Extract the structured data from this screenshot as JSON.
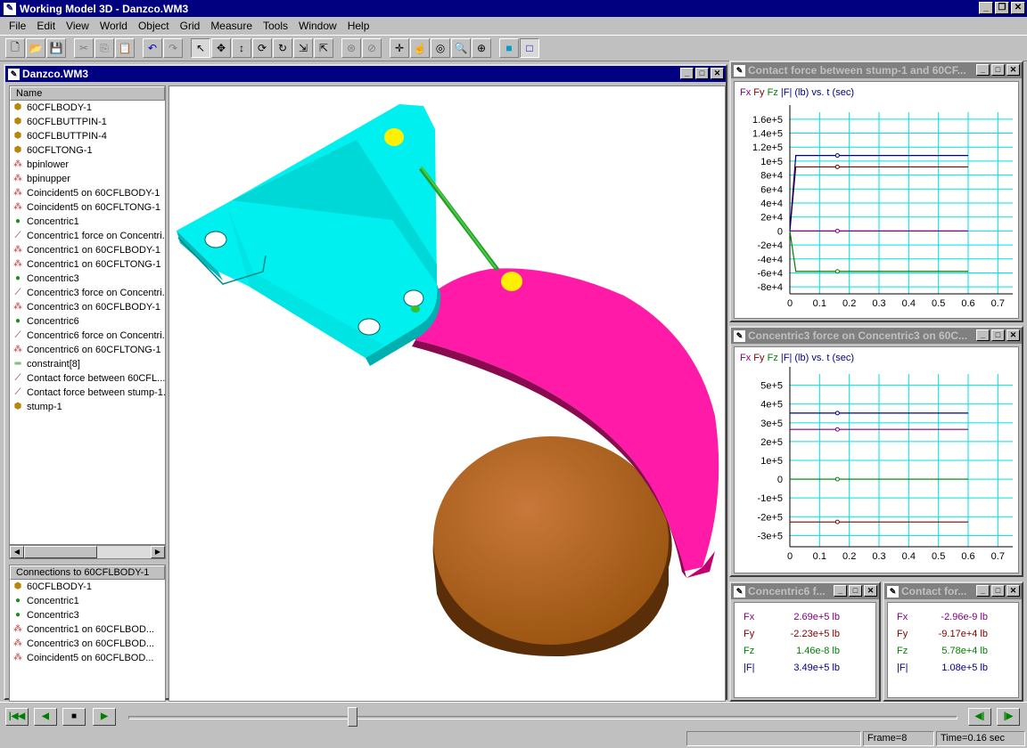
{
  "app": {
    "title": "Working Model 3D - Danzco.WM3"
  },
  "menu": [
    "File",
    "Edit",
    "View",
    "World",
    "Object",
    "Grid",
    "Measure",
    "Tools",
    "Window",
    "Help"
  ],
  "toolbar_icons": [
    "new",
    "open",
    "save",
    "cut",
    "copy",
    "paste",
    "undo",
    "redo",
    "pointer",
    "move",
    "rotate",
    "orbit",
    "spin",
    "join",
    "split",
    "anchor",
    "unanchor",
    "pan",
    "rotate-view",
    "zoom-window",
    "zoom-fit",
    "shaded-view",
    "wireframe-view"
  ],
  "model_window": {
    "title": "Danzco.WM3",
    "tree_header": "Name",
    "items": [
      {
        "label": "60CFLBODY-1",
        "icon": "body"
      },
      {
        "label": "60CFLBUTTPIN-1",
        "icon": "body"
      },
      {
        "label": "60CFLBUTTPIN-4",
        "icon": "body"
      },
      {
        "label": "60CFLTONG-1",
        "icon": "body"
      },
      {
        "label": "bpinlower",
        "icon": "point"
      },
      {
        "label": "bpinupper",
        "icon": "point"
      },
      {
        "label": "Coincident5 on 60CFLBODY-1",
        "icon": "point"
      },
      {
        "label": "Coincident5 on 60CFLTONG-1",
        "icon": "point"
      },
      {
        "label": "Concentric1",
        "icon": "concentric"
      },
      {
        "label": "Concentric1 force on Concentri...",
        "icon": "meter"
      },
      {
        "label": "Concentric1 on 60CFLBODY-1",
        "icon": "point"
      },
      {
        "label": "Concentric1 on 60CFLTONG-1",
        "icon": "point"
      },
      {
        "label": "Concentric3",
        "icon": "concentric"
      },
      {
        "label": "Concentric3 force on Concentri...",
        "icon": "meter"
      },
      {
        "label": "Concentric3 on 60CFLBODY-1",
        "icon": "point"
      },
      {
        "label": "Concentric6",
        "icon": "concentric"
      },
      {
        "label": "Concentric6 force on Concentri...",
        "icon": "meter"
      },
      {
        "label": "Concentric6 on 60CFLTONG-1",
        "icon": "point"
      },
      {
        "label": "constraint[8]",
        "icon": "constraint"
      },
      {
        "label": "Contact force between 60CFL...",
        "icon": "meter"
      },
      {
        "label": "Contact force between stump-1...",
        "icon": "meter"
      },
      {
        "label": "stump-1",
        "icon": "body"
      }
    ],
    "connections_header": "Connections to 60CFLBODY-1",
    "connections": [
      {
        "label": "60CFLBODY-1",
        "icon": "body"
      },
      {
        "label": "Concentric1",
        "icon": "concentric"
      },
      {
        "label": "Concentric3",
        "icon": "concentric"
      },
      {
        "label": "Concentric1 on 60CFLBOD...",
        "icon": "point"
      },
      {
        "label": "Concentric3 on 60CFLBOD...",
        "icon": "point"
      },
      {
        "label": "Coincident5 on 60CFLBOD...",
        "icon": "point"
      }
    ]
  },
  "graph1": {
    "title": "Contact force between stump-1 and 60CF...",
    "legend": [
      "Fx",
      "Fy",
      "Fz",
      "|F| (lb) vs. t (sec)"
    ]
  },
  "graph2": {
    "title": "Concentric3 force on Concentric3 on 60C...",
    "legend": [
      "Fx",
      "Fy",
      "Fz",
      "|F| (lb) vs. t (sec)"
    ]
  },
  "meter1": {
    "title": "Concentric6 f...",
    "rows": [
      {
        "label": "Fx",
        "value": "2.69e+5 lb"
      },
      {
        "label": "Fy",
        "value": "-2.23e+5 lb"
      },
      {
        "label": "Fz",
        "value": "1.46e-8 lb"
      },
      {
        "label": "|F|",
        "value": "3.49e+5 lb"
      }
    ]
  },
  "meter2": {
    "title": "Contact for...",
    "rows": [
      {
        "label": "Fx",
        "value": "-2.96e-9 lb"
      },
      {
        "label": "Fy",
        "value": "-9.17e+4 lb"
      },
      {
        "label": "Fz",
        "value": "5.78e+4 lb"
      },
      {
        "label": "|F|",
        "value": "1.08e+5 lb"
      }
    ]
  },
  "colors": {
    "fx": "#800080",
    "fy": "#800000",
    "fz": "#008000",
    "mag": "#000080",
    "grid": "#00e0e0"
  },
  "playback": {
    "progress": 0.27
  },
  "status": {
    "frame": "Frame=8",
    "time": "Time=0.16 sec"
  },
  "chart_data": [
    {
      "type": "line",
      "title": "Contact force between stump-1 and 60CF...",
      "xlabel": "t (sec)",
      "ylabel": "|F| (lb)",
      "x_ticks": [
        "0",
        "0.1",
        "0.2",
        "0.3",
        "0.4",
        "0.5",
        "0.6",
        "0.7"
      ],
      "xlim": [
        0,
        0.75
      ],
      "y_ticks": [
        "1.6e+5",
        "1.4e+5",
        "1.2e+5",
        "1e+5",
        "8e+4",
        "6e+4",
        "4e+4",
        "2e+4",
        "0",
        "-2e+4",
        "-4e+4",
        "-6e+4",
        "-8e+4"
      ],
      "ylim": [
        -90000,
        170000
      ],
      "series": [
        {
          "name": "Fx",
          "x": [
            0,
            0.6
          ],
          "y": [
            0,
            0
          ]
        },
        {
          "name": "Fy",
          "x": [
            0,
            0.02,
            0.6
          ],
          "y": [
            0,
            91700,
            91700
          ]
        },
        {
          "name": "Fz",
          "x": [
            0,
            0.02,
            0.6
          ],
          "y": [
            0,
            -57800,
            -57800
          ]
        },
        {
          "name": "|F|",
          "x": [
            0,
            0.02,
            0.6
          ],
          "y": [
            0,
            108000,
            108000
          ]
        }
      ],
      "marker_x": 0.16
    },
    {
      "type": "line",
      "title": "Concentric3 force on Concentric3 on 60C...",
      "xlabel": "t (sec)",
      "ylabel": "|F| (lb)",
      "x_ticks": [
        "0",
        "0.1",
        "0.2",
        "0.3",
        "0.4",
        "0.5",
        "0.6",
        "0.7"
      ],
      "xlim": [
        0,
        0.75
      ],
      "y_ticks": [
        "5e+5",
        "4e+5",
        "3e+5",
        "2e+5",
        "1e+5",
        "0",
        "-1e+5",
        "-2e+5",
        "-3e+5"
      ],
      "ylim": [
        -360000,
        560000
      ],
      "series": [
        {
          "name": "Fx",
          "x": [
            0,
            0.6
          ],
          "y": [
            265000,
            265000
          ]
        },
        {
          "name": "Fy",
          "x": [
            0,
            0.6
          ],
          "y": [
            -228000,
            -228000
          ]
        },
        {
          "name": "Fz",
          "x": [
            0,
            0.6
          ],
          "y": [
            0,
            0
          ]
        },
        {
          "name": "|F|",
          "x": [
            0,
            0.6
          ],
          "y": [
            352000,
            352000
          ]
        }
      ],
      "marker_x": 0.16
    }
  ]
}
